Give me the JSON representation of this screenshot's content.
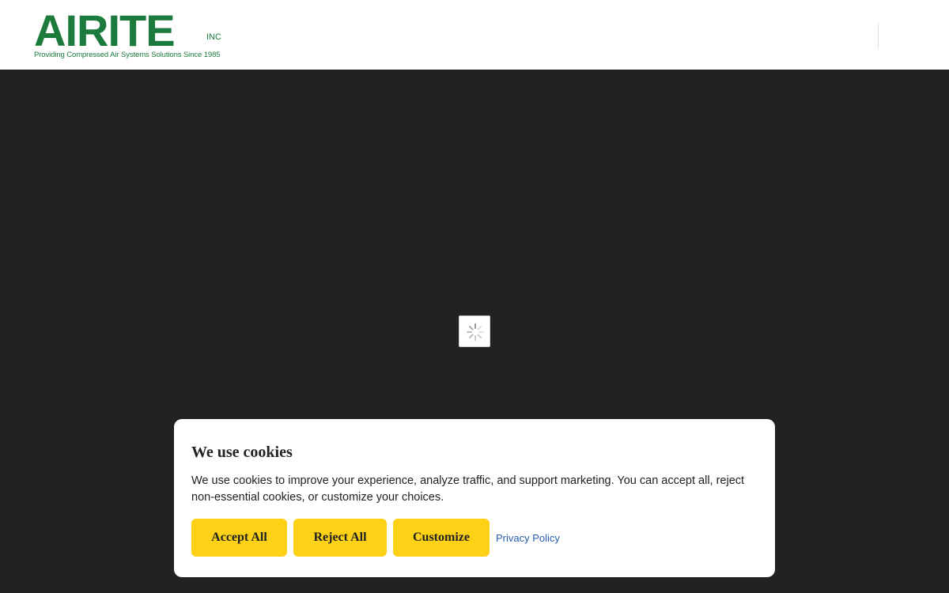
{
  "header": {
    "logo": {
      "wordmark": "AIRITE",
      "suffix": "INC",
      "tagline": "Providing Compressed Air Systems Solutions Since 1985"
    }
  },
  "colors": {
    "brand_green": "#1c7a3c",
    "page_background": "#222222",
    "button_yellow": "#fcd116",
    "link_blue": "#2a5db0"
  },
  "loader": {
    "icon": "spinner-icon"
  },
  "cookie_banner": {
    "title": "We use cookies",
    "message": "We use cookies to improve your experience, analyze traffic, and support marketing. You can accept all, reject non-essential cookies, or customize your choices.",
    "accept_label": "Accept All",
    "reject_label": "Reject All",
    "customize_label": "Customize",
    "privacy_label": "Privacy Policy"
  }
}
